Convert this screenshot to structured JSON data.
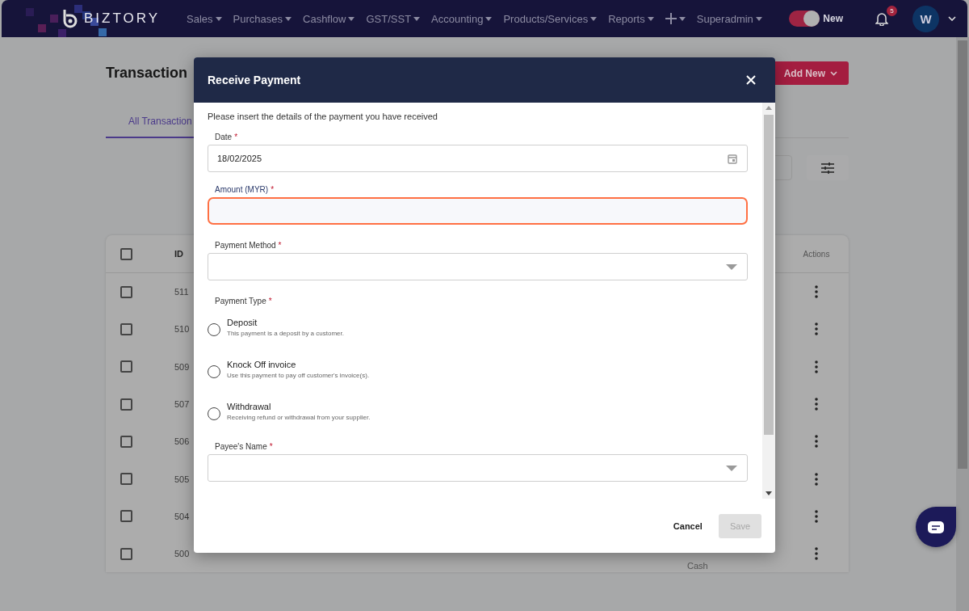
{
  "navbar": {
    "brand": "BIZTORY",
    "menu": [
      {
        "kind": "text",
        "label": "Sales"
      },
      {
        "kind": "text",
        "label": "Purchases"
      },
      {
        "kind": "text",
        "label": "Cashflow"
      },
      {
        "kind": "text",
        "label": "GST/SST"
      },
      {
        "kind": "text",
        "label": "Accounting"
      },
      {
        "kind": "text",
        "label": "Products/Services"
      },
      {
        "kind": "text",
        "label": "Reports"
      },
      {
        "kind": "plus"
      },
      {
        "kind": "text",
        "label": "Superadmin"
      }
    ],
    "toggle": {
      "label": "New",
      "on": true
    },
    "notifications": {
      "count": "5"
    },
    "avatar": {
      "initial": "W"
    }
  },
  "page": {
    "title": "Transaction",
    "add_button": "Add New",
    "tabs": [
      {
        "label": "All Transaction",
        "selected": true
      }
    ],
    "table": {
      "select_all_checked": false,
      "columns": [
        "ID",
        "Actions"
      ],
      "rows": [
        {
          "id": "511",
          "checked": false
        },
        {
          "id": "510",
          "checked": false
        },
        {
          "id": "509",
          "checked": false
        },
        {
          "id": "507",
          "checked": false
        },
        {
          "id": "506",
          "checked": false
        },
        {
          "id": "505",
          "checked": false
        },
        {
          "id": "504",
          "checked": false
        },
        {
          "id": "500",
          "checked": false,
          "method": "Cash"
        }
      ]
    }
  },
  "modal": {
    "title": "Receive Payment",
    "intro": "Please insert the details of the payment you have received",
    "fields": [
      {
        "kind": "date",
        "label": "Date",
        "required_mark": "*",
        "value": "18/02/2025",
        "focused": false
      },
      {
        "kind": "text",
        "label": "Amount (MYR)",
        "required_mark": "*",
        "focused": true
      },
      {
        "kind": "select",
        "label": "Payment Method",
        "required_mark": "*",
        "focused": false
      },
      {
        "kind": "radio",
        "label": "Payment Type",
        "required_mark": "*",
        "options": [
          {
            "label": "Deposit",
            "description": "This payment is a deposit by a customer.",
            "selected": false
          },
          {
            "label": "Knock Off invoice",
            "description": "Use this payment to pay off customer's invoice(s).",
            "selected": false
          },
          {
            "label": "Withdrawal",
            "description": "Receiving refund or withdrawal from your supplier.",
            "selected": false
          }
        ]
      },
      {
        "kind": "select",
        "label": "Payee's Name",
        "required_mark": "*",
        "focused": false
      }
    ],
    "buttons": [
      {
        "kind": "cancel",
        "label": "Cancel",
        "disabled": false
      },
      {
        "kind": "save",
        "label": "Save",
        "disabled": true
      }
    ]
  }
}
